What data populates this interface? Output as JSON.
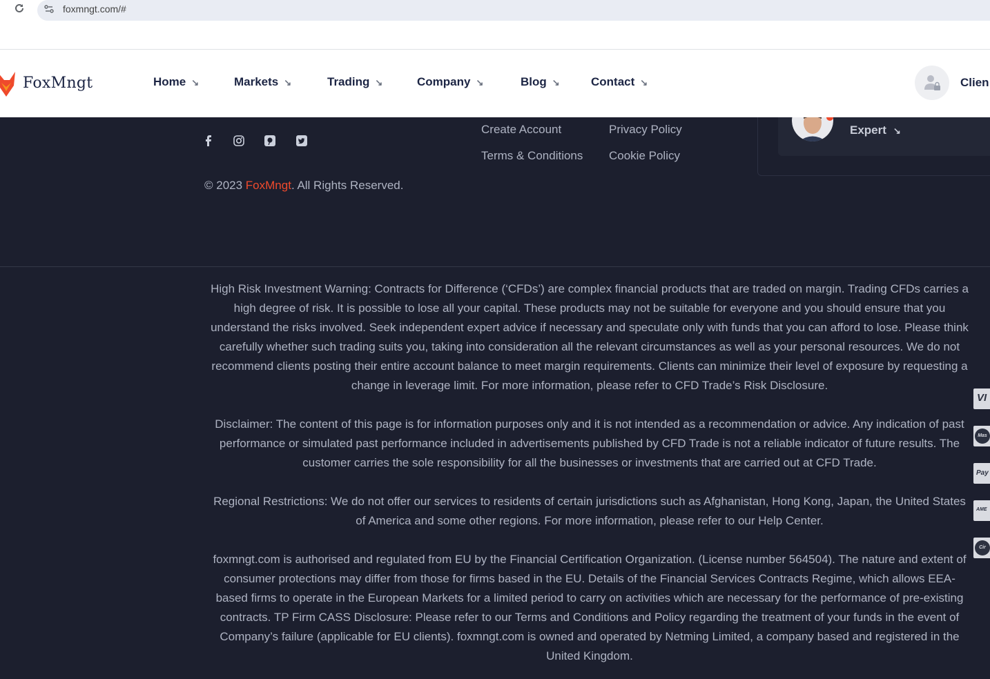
{
  "browser": {
    "url": "foxmngt.com/#"
  },
  "header": {
    "logo_text": "FoxMngt",
    "nav": [
      {
        "label": "Home"
      },
      {
        "label": "Markets"
      },
      {
        "label": "Trading"
      },
      {
        "label": "Company"
      },
      {
        "label": "Blog"
      },
      {
        "label": "Contact"
      }
    ],
    "nav_arrow": "↘",
    "client_label": "Clien"
  },
  "footer": {
    "social": [
      "facebook-icon",
      "instagram-icon",
      "pinterest-icon",
      "twitter-icon"
    ],
    "links": {
      "create_account": "Create Account",
      "terms": "Terms & Conditions",
      "privacy": "Privacy Policy",
      "cookie": "Cookie Policy"
    },
    "copyright_prefix": "© 2023 ",
    "copyright_brand": "FoxMngt",
    "copyright_suffix": ". All Rights Reserved.",
    "expert_label": "Expert",
    "expert_arrow": "↘"
  },
  "legal": {
    "risk_warning": "High Risk Investment Warning: Contracts for Difference (‘CFDs’) are complex financial products that are traded on margin. Trading CFDs carries a high degree of risk. It is possible to lose all your capital. These products may not be suitable for everyone and you should ensure that you understand the risks involved. Seek independent expert advice if necessary and speculate only with funds that you can afford to lose. Please think carefully whether such trading suits you, taking into consideration all the relevant circumstances as well as your personal resources. We do not recommend clients posting their entire account balance to meet margin requirements. Clients can minimize their level of exposure by requesting a change in leverage limit. For more information, please refer to CFD Trade’s Risk Disclosure.",
    "disclaimer": "Disclaimer: The content of this page is for information purposes only and it is not intended as a recommendation or advice. Any indication of past performance or simulated past performance included in advertisements published by CFD Trade is not a reliable indicator of future results. The customer carries the sole responsibility for all the businesses or investments that are carried out at CFD Trade.",
    "regional": "Regional Restrictions: We do not offer our services to residents of certain jurisdictions such as Afghanistan, Hong Kong, Japan, the United States of America and some other regions. For more information, please refer to our Help Center.",
    "regulation": "foxmngt.com is authorised and regulated from EU by the Financial Certification Organization. (License number 564504). The nature and extent of consumer protections may differ from those for firms based in the EU. Details of the Financial Services Contracts Regime, which allows EEA-based firms to operate in the European Markets for a limited period to carry on activities which are necessary for the performance of pre-existing contracts. TP Firm CASS Disclosure: Please refer to our Terms and Conditions and Policy regarding the treatment of your funds in the event of Company’s failure (applicable for EU clients). foxmngt.com is owned and operated by Netming Limited, a company based and registered in the United Kingdom."
  },
  "payments": [
    "VI",
    "Mas",
    "Pay",
    "AME",
    "Cir"
  ],
  "colors": {
    "brand": "#ef4a2c",
    "dark_bg": "#1c1f2e",
    "text_muted": "#aeb3c2"
  }
}
